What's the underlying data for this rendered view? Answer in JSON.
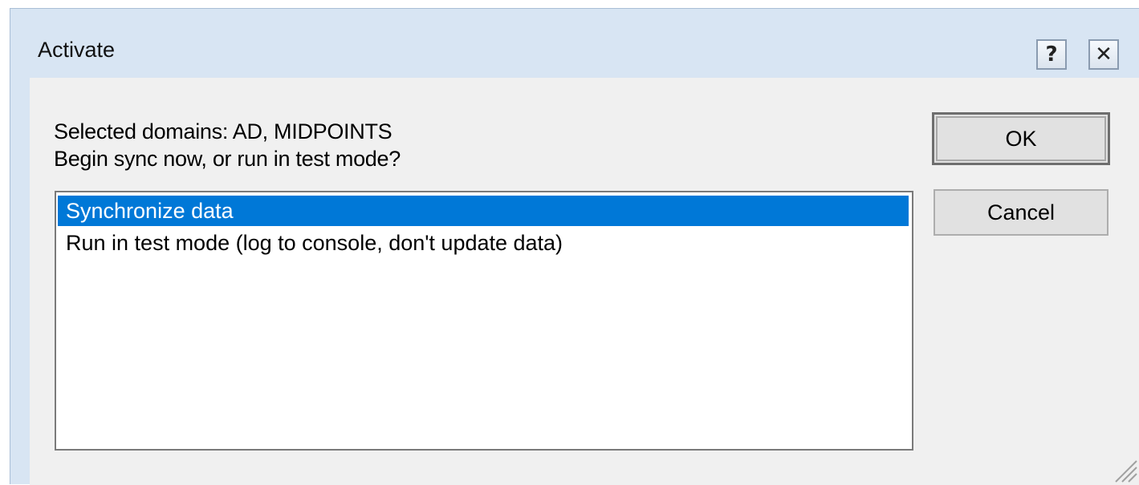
{
  "window": {
    "title": "Activate",
    "help_label": "?",
    "close_label": "✕"
  },
  "message": {
    "line1": "Selected domains: AD, MIDPOINTS",
    "line2": "Begin sync now, or run in test mode?"
  },
  "options": [
    {
      "label": "Synchronize data",
      "selected": true
    },
    {
      "label": "Run in test mode (log to console, don't update data)",
      "selected": false
    }
  ],
  "buttons": {
    "ok_label": "OK",
    "cancel_label": "Cancel"
  },
  "colors": {
    "selection": "#0078d7",
    "titlebar": "#d8e5f3",
    "client": "#f0f0f0"
  }
}
